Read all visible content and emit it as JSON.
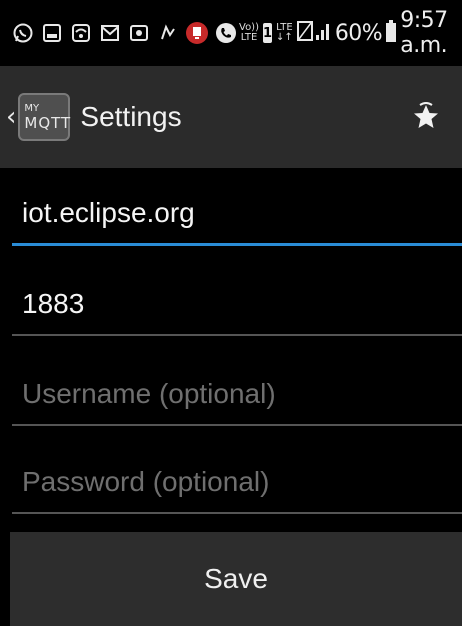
{
  "status_bar": {
    "left_icons": [
      "whatsapp-icon",
      "notification-icon",
      "wifi-icon",
      "mail-icon",
      "gallery-icon",
      "app-icon",
      "alert-icon",
      "phone-icon"
    ],
    "volte_label_top": "Vo))",
    "volte_label_bottom": "LTE",
    "sim_label": "1",
    "lte_label": "LTE",
    "battery_percent": "60%",
    "time": "9:57 a.m."
  },
  "action_bar": {
    "logo_line1": "MY",
    "logo_line2": "MQTT",
    "title": "Settings"
  },
  "form": {
    "host_value": "iot.eclipse.org",
    "port_value": "1883",
    "username_placeholder": "Username (optional)",
    "password_placeholder": "Password (optional)",
    "save_label": "Save"
  },
  "colors": {
    "accent": "#2a8cd6",
    "action_bar": "#2b2b2b",
    "button": "#2d2d2d",
    "placeholder": "#6f6f6f"
  }
}
